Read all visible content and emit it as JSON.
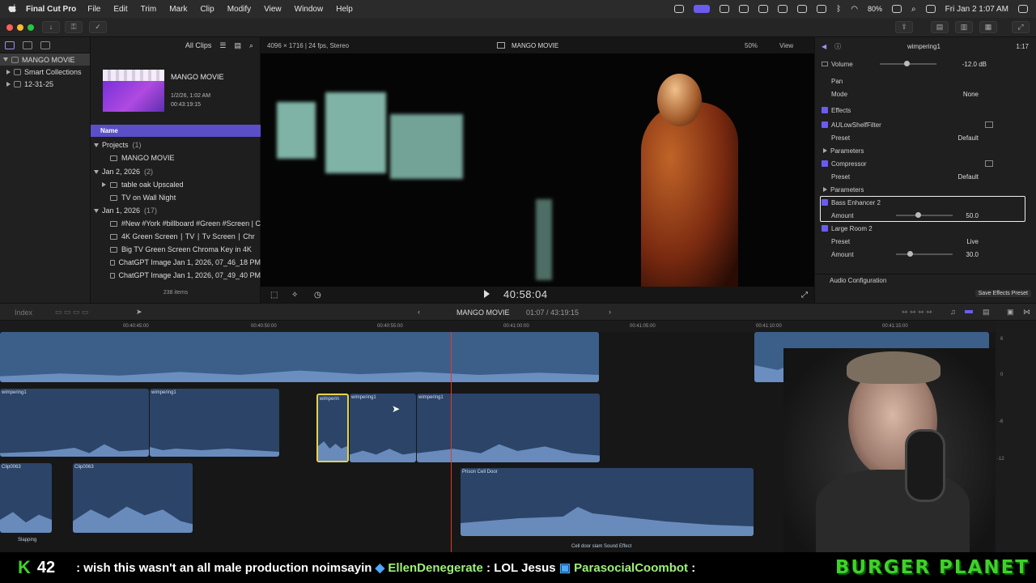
{
  "menubar": {
    "app": "Final Cut Pro",
    "items": [
      "File",
      "Edit",
      "Trim",
      "Mark",
      "Clip",
      "Modify",
      "View",
      "Window",
      "Help"
    ],
    "battery": "80%",
    "clock": "Fri Jan 2  1:07 AM"
  },
  "library": {
    "items": [
      {
        "label": "MANGO MOVIE"
      },
      {
        "label": "Smart Collections"
      },
      {
        "label": "12-31-25"
      }
    ]
  },
  "browser": {
    "filter": "All Clips",
    "project": {
      "name": "MANGO MOVIE",
      "date": "1/2/26, 1:02 AM",
      "duration": "00:43:19:15"
    },
    "column_header": "Name",
    "rows": [
      {
        "label": "Projects",
        "count": "(1)"
      },
      {
        "label": "MANGO MOVIE",
        "count": ""
      },
      {
        "label": "Jan 2, 2026",
        "count": "(2)"
      },
      {
        "label": "table oak Upscaled",
        "count": ""
      },
      {
        "label": "TV on Wall Night",
        "count": ""
      },
      {
        "label": "Jan 1, 2026",
        "count": "(17)"
      },
      {
        "label": "#New #York #billboard #Green #Screen | C",
        "count": ""
      },
      {
        "label": "4K Green Screen ∣ TV ∣ Tv Screen ∣ Chr",
        "count": ""
      },
      {
        "label": "Big TV Green Screen Chroma Key in 4K",
        "count": ""
      },
      {
        "label": "ChatGPT Image Jan 1, 2026, 07_46_18 PM",
        "count": ""
      },
      {
        "label": "ChatGPT Image Jan 1, 2026, 07_49_40 PM",
        "count": ""
      }
    ],
    "item_count": "238 items"
  },
  "viewer": {
    "format": "4096 × 1716 | 24 fps, Stereo",
    "title": "MANGO MOVIE",
    "zoom": "50%",
    "view": "View",
    "timecode": "40:58:04"
  },
  "inspector": {
    "clip": "wimpering1",
    "duration": "1:17",
    "rows": [
      {
        "label": "Volume",
        "value": "-12.0 dB"
      },
      {
        "label": "Pan",
        "value": ""
      },
      {
        "label": "Mode",
        "value": "None"
      },
      {
        "label": "Effects",
        "value": ""
      },
      {
        "label": "AULowShelfFilter",
        "value": ""
      },
      {
        "label": "Preset",
        "value": "Default"
      },
      {
        "label": "Parameters",
        "value": ""
      },
      {
        "label": "Compressor",
        "value": ""
      },
      {
        "label": "Preset",
        "value": "Default"
      },
      {
        "label": "Parameters",
        "value": ""
      },
      {
        "label": "Bass Enhancer 2",
        "value": ""
      },
      {
        "label": "Amount",
        "value": "50.0"
      },
      {
        "label": "Large Room 2",
        "value": ""
      },
      {
        "label": "Preset",
        "value": "Live"
      },
      {
        "label": "Amount",
        "value": "30.0"
      },
      {
        "label": "Audio Configuration",
        "value": ""
      }
    ],
    "save_button": "Save Effects Preset"
  },
  "timeline": {
    "index": "Index",
    "project": "MANGO MOVIE",
    "position": "01:07 / 43:19:15",
    "ruler": [
      "00:40:45:00",
      "00:40:50:00",
      "00:40:55:00",
      "00:41:00:00",
      "00:41:05:00",
      "00:41:10:00",
      "00:41:15:00"
    ],
    "clips": [
      {
        "label": ""
      },
      {
        "label": ""
      },
      {
        "label": "wimpering1"
      },
      {
        "label": "wimpering1"
      },
      {
        "label": "wimperin"
      },
      {
        "label": "wimpering1"
      },
      {
        "label": "wimpering1"
      },
      {
        "label": "Clip0063"
      },
      {
        "label": "Clip0063"
      },
      {
        "label": "Prison Cell Door"
      },
      {
        "label": "Cell door slam Sound Effect"
      },
      {
        "label": "Slapping"
      }
    ],
    "meter": [
      "6",
      "0",
      "-6",
      "-12"
    ]
  },
  "stream": {
    "k_label": "K",
    "count": "42",
    "ticker": ": wish this wasn't an all male production noimsayin",
    "user1": "EllenDenegerate",
    "msg1": ": LOL Jesus",
    "user2": "ParasocialCoombot",
    "msg2": ":",
    "brand": "BURGER PLANET"
  }
}
